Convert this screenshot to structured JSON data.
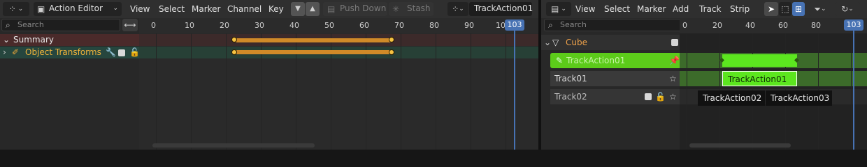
{
  "action_editor": {
    "mode_label": "Action Editor",
    "menus": [
      "View",
      "Select",
      "Marker",
      "Channel",
      "Key"
    ],
    "push_down_label": "Push Down",
    "stash_label": "Stash",
    "action_name": "TrackAction01",
    "search_placeholder": "Search",
    "ruler_ticks": [
      "0",
      "10",
      "20",
      "30",
      "40",
      "50",
      "60",
      "70",
      "80",
      "90",
      "100"
    ],
    "playhead_frame": "103",
    "channels": [
      {
        "label": "Summary",
        "keys": [
          23,
          68
        ]
      },
      {
        "label": "Object Transforms",
        "keys": [
          23,
          68
        ]
      }
    ],
    "colors": {
      "summary_row": "#4a2a2a",
      "transforms_row": "#26463e",
      "keyframe": "#f6c342",
      "hold_bar": "#d08a28",
      "playhead": "#4772b3"
    }
  },
  "nla_editor": {
    "menus": [
      "View",
      "Select",
      "Marker",
      "Add",
      "Track",
      "Strip"
    ],
    "search_placeholder": "Search",
    "ruler_ticks": [
      "0",
      "20",
      "40",
      "60",
      "80"
    ],
    "playhead_frame": "103",
    "object_name": "Cube",
    "tracks": [
      {
        "label": "TrackAction01"
      },
      {
        "label": "Track01",
        "strips": [
          "TrackAction01"
        ]
      },
      {
        "label": "Track02",
        "strips": [
          "TrackAction02",
          "TrackAction03"
        ]
      }
    ],
    "colors": {
      "action_track": "#5ccb1a",
      "active_strip": "#5ce61f",
      "strip_dark": "#111111"
    }
  }
}
